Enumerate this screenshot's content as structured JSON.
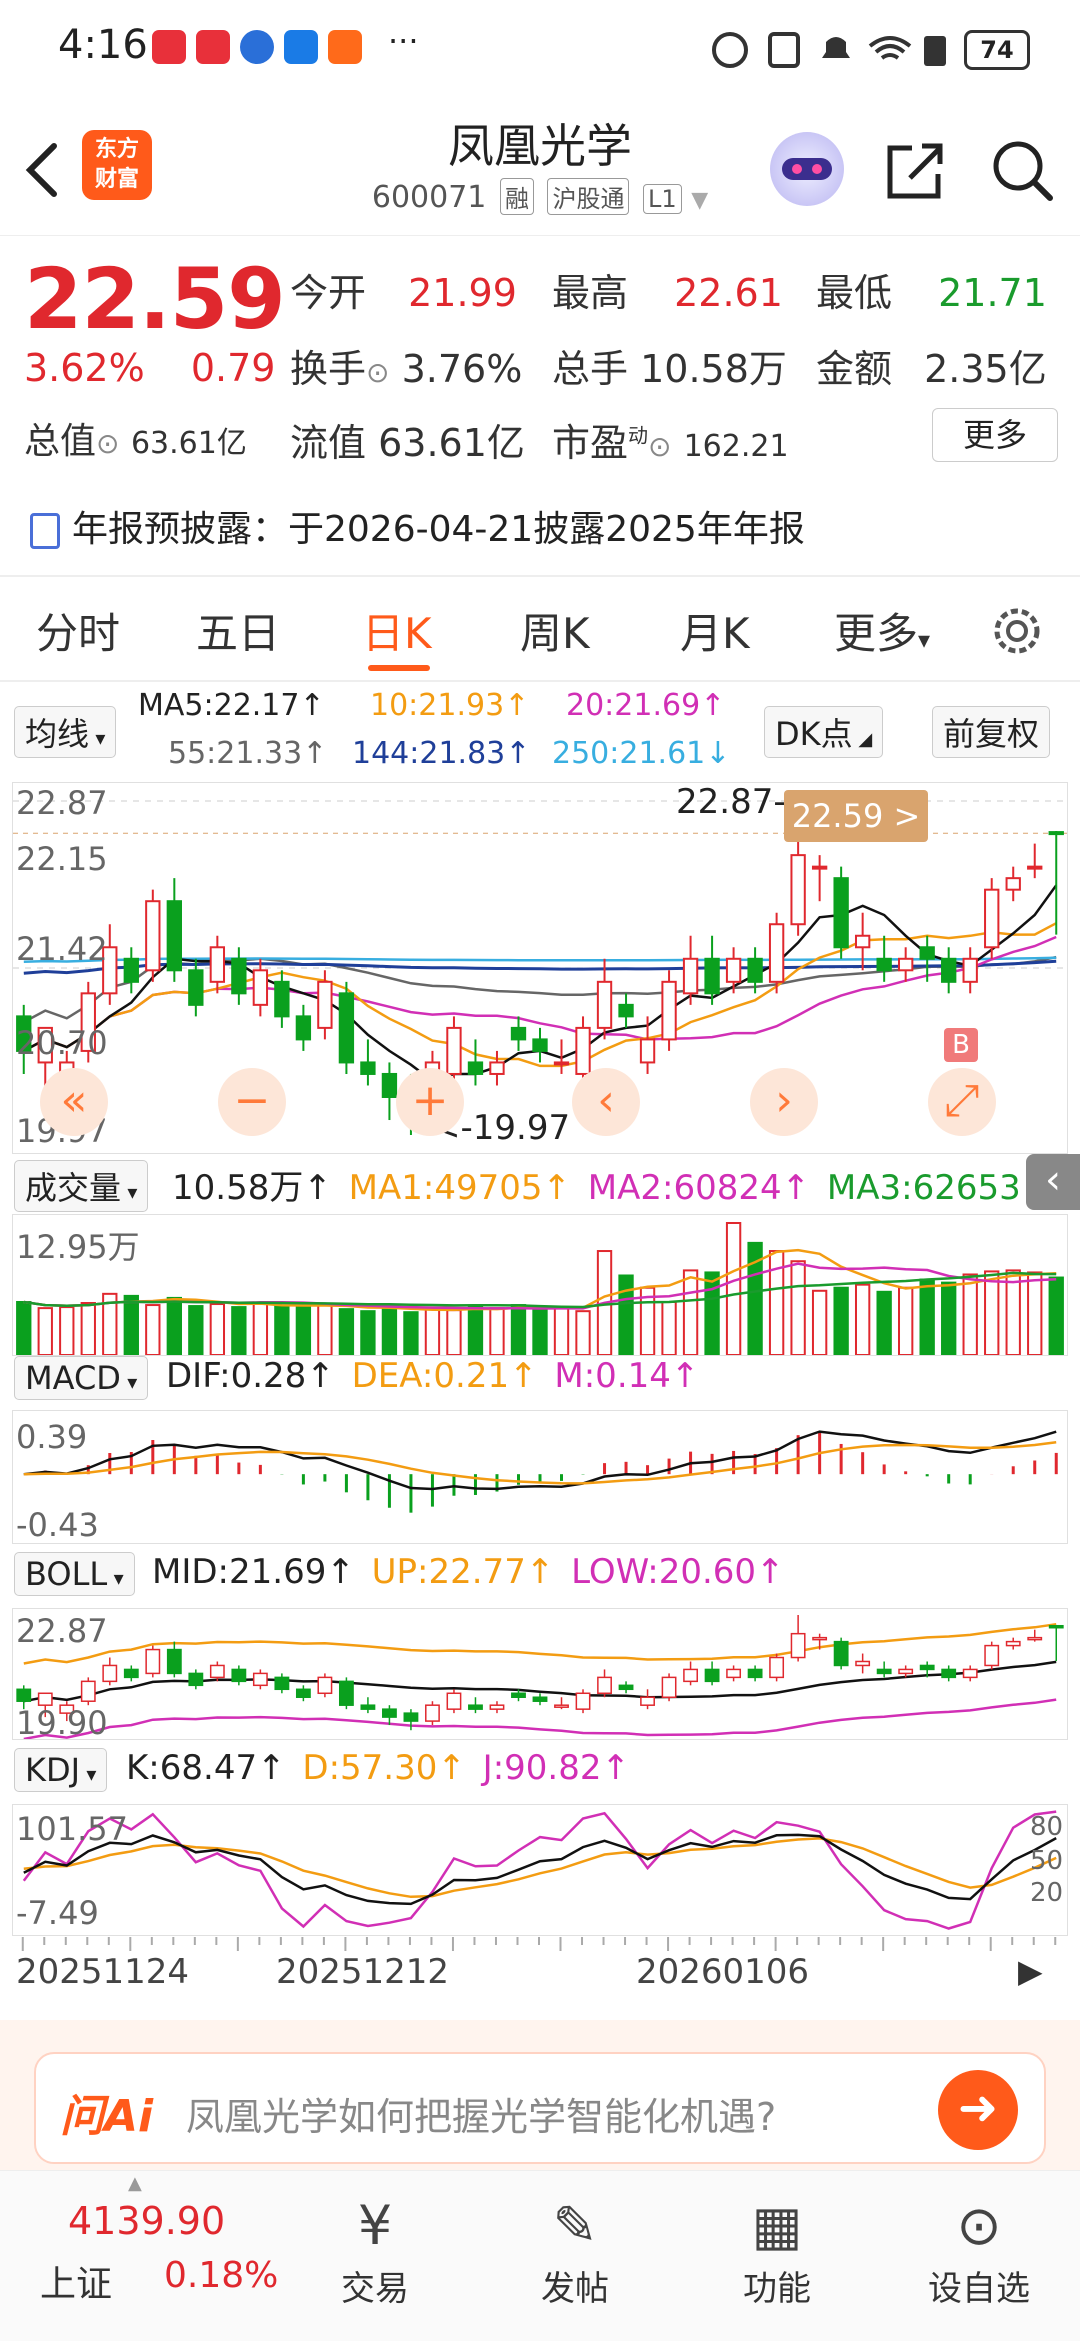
{
  "status_bar": {
    "time": "4:16",
    "more": "···",
    "battery": "74"
  },
  "header": {
    "back_icon": "chevron-left-icon",
    "logo_line1": "东方",
    "logo_line2": "财富",
    "title": "凤凰光学",
    "code": "600071",
    "tags": [
      "融",
      "沪股通",
      "L1"
    ],
    "robot_icon": "robot-avatar-icon",
    "share_icon": "share-icon",
    "search_icon": "search-icon"
  },
  "quote": {
    "price": "22.59",
    "change_pct": "3.62%",
    "change": "0.79",
    "open_label": "今开",
    "open": "21.99",
    "high_label": "最高",
    "high": "22.61",
    "low_label": "最低",
    "low": "21.71",
    "turnover_label": "换手",
    "turnover": "3.76%",
    "volume_label": "总手",
    "volume": "10.58万",
    "amount_label": "金额",
    "amount": "2.35亿",
    "mktcap_label": "总值",
    "mktcap": "63.61亿",
    "float_label": "流值",
    "float_cap": "63.61亿",
    "pe_label": "市盈",
    "pe_sup": "动",
    "pe": "162.21",
    "more_button": "更多"
  },
  "notice": {
    "icon": "report-icon",
    "text": "年报预披露：于2026-04-21披露2025年年报"
  },
  "tabs": [
    "分时",
    "五日",
    "日K",
    "周K",
    "月K",
    "更多"
  ],
  "active_tab": "日K",
  "ma_legend": {
    "selector": "均线",
    "ma5": "MA5:22.17↑",
    "ma10": "10:21.93↑",
    "ma20": "20:21.69↑",
    "ma55": "55:21.33↑",
    "ma144": "144:21.83↑",
    "ma250": "250:21.61↓",
    "dk_button": "DK点",
    "adjust_button": "前复权"
  },
  "kline": {
    "y_labels": [
      "22.87",
      "22.15",
      "21.42",
      "20.70",
      "19.97"
    ],
    "high_marker": "22.87-",
    "low_marker": "<-19.97",
    "price_tag": "22.59 >",
    "buy_marker": "B"
  },
  "volume": {
    "selector": "成交量",
    "value": "10.58万↑",
    "ma1": "MA1:49705↑",
    "ma2": "MA2:60824↑",
    "ma3": "MA3:62653↑",
    "max_label": "12.95万"
  },
  "macd": {
    "selector": "MACD",
    "dif": "DIF:0.28↑",
    "dea": "DEA:0.21↑",
    "m": "M:0.14↑",
    "top": "0.39",
    "bottom": "-0.43"
  },
  "boll": {
    "selector": "BOLL",
    "mid": "MID:21.69↑",
    "up": "UP:22.77↑",
    "low": "LOW:20.60↑",
    "top": "22.87",
    "bottom": "19.90"
  },
  "kdj": {
    "selector": "KDJ",
    "k": "K:68.47↑",
    "d": "D:57.30↑",
    "j": "J:90.82↑",
    "top": "101.57",
    "bottom": "-7.49",
    "r80": "80",
    "r50": "50",
    "r20": "20"
  },
  "x_dates": [
    "20251124",
    "20251212",
    "20260106"
  ],
  "ai": {
    "logo": "问Ai",
    "prompt": "凤凰光学如何把握光学智能化机遇?"
  },
  "bottom_nav": {
    "index_value": "4139.90",
    "index_name": "上证",
    "index_change": "0.18%",
    "items": [
      "交易",
      "发帖",
      "功能",
      "设自选"
    ]
  },
  "kline_data": {
    "open": [
      21.0,
      20.6,
      20.4,
      20.7,
      21.2,
      21.5,
      21.4,
      22.0,
      21.4,
      21.3,
      21.5,
      21.1,
      21.3,
      21.0,
      20.9,
      21.2,
      20.6,
      20.5,
      20.4,
      20.2,
      20.5,
      20.6,
      20.5,
      20.9,
      20.8,
      20.6,
      20.5,
      20.9,
      21.1,
      20.6,
      20.8,
      21.2,
      21.5,
      21.3,
      21.5,
      21.3,
      21.8,
      22.3,
      22.2,
      21.6,
      21.5,
      21.4,
      21.6,
      21.5,
      21.3,
      21.6,
      22.1,
      22.3,
      22.6
    ],
    "close": [
      20.7,
      20.9,
      20.6,
      21.2,
      21.6,
      21.3,
      22.0,
      21.4,
      21.1,
      21.6,
      21.2,
      21.4,
      21.0,
      20.8,
      21.3,
      20.6,
      20.5,
      20.3,
      20.2,
      20.6,
      20.9,
      20.5,
      20.6,
      20.8,
      20.7,
      20.6,
      20.9,
      21.3,
      21.0,
      20.8,
      21.3,
      21.5,
      21.2,
      21.5,
      21.3,
      21.8,
      22.4,
      22.3,
      21.6,
      21.7,
      21.4,
      21.5,
      21.5,
      21.3,
      21.5,
      22.1,
      22.2,
      22.3,
      22.59
    ],
    "high": [
      21.1,
      20.9,
      20.7,
      21.3,
      21.8,
      21.6,
      22.1,
      22.2,
      21.5,
      21.7,
      21.6,
      21.5,
      21.4,
      21.1,
      21.4,
      21.3,
      20.8,
      20.6,
      20.5,
      20.7,
      21.0,
      20.8,
      20.7,
      21.0,
      20.9,
      20.8,
      21.0,
      21.5,
      21.2,
      21.0,
      21.4,
      21.7,
      21.7,
      21.6,
      21.6,
      21.9,
      22.87,
      22.4,
      22.3,
      21.9,
      21.7,
      21.6,
      21.7,
      21.6,
      21.6,
      22.2,
      22.3,
      22.5,
      22.61
    ],
    "low": [
      20.5,
      20.3,
      20.2,
      20.6,
      21.1,
      21.2,
      21.3,
      21.3,
      21.0,
      21.2,
      21.1,
      21.0,
      20.9,
      20.7,
      20.8,
      20.5,
      20.4,
      20.1,
      19.97,
      20.1,
      20.4,
      20.4,
      20.4,
      20.7,
      20.6,
      20.5,
      20.4,
      20.8,
      20.9,
      20.5,
      20.7,
      21.1,
      21.1,
      21.2,
      21.2,
      21.2,
      21.7,
      22.0,
      21.5,
      21.4,
      21.3,
      21.3,
      21.3,
      21.2,
      21.2,
      21.5,
      22.0,
      22.2,
      21.71
    ],
    "volumes": [
      5.2,
      4.6,
      4.7,
      5.1,
      6.0,
      5.8,
      4.9,
      5.6,
      4.8,
      5.0,
      4.7,
      5.1,
      4.8,
      4.7,
      5.0,
      4.5,
      4.3,
      4.7,
      4.2,
      4.5,
      4.4,
      4.8,
      4.6,
      4.9,
      4.7,
      4.6,
      4.3,
      10.2,
      7.8,
      6.6,
      5.2,
      8.3,
      8.1,
      12.95,
      11.0,
      10.2,
      9.2,
      6.3,
      6.6,
      6.9,
      6.2,
      6.6,
      7.4,
      7.1,
      7.9,
      8.2,
      8.3,
      8.1,
      7.6
    ]
  }
}
